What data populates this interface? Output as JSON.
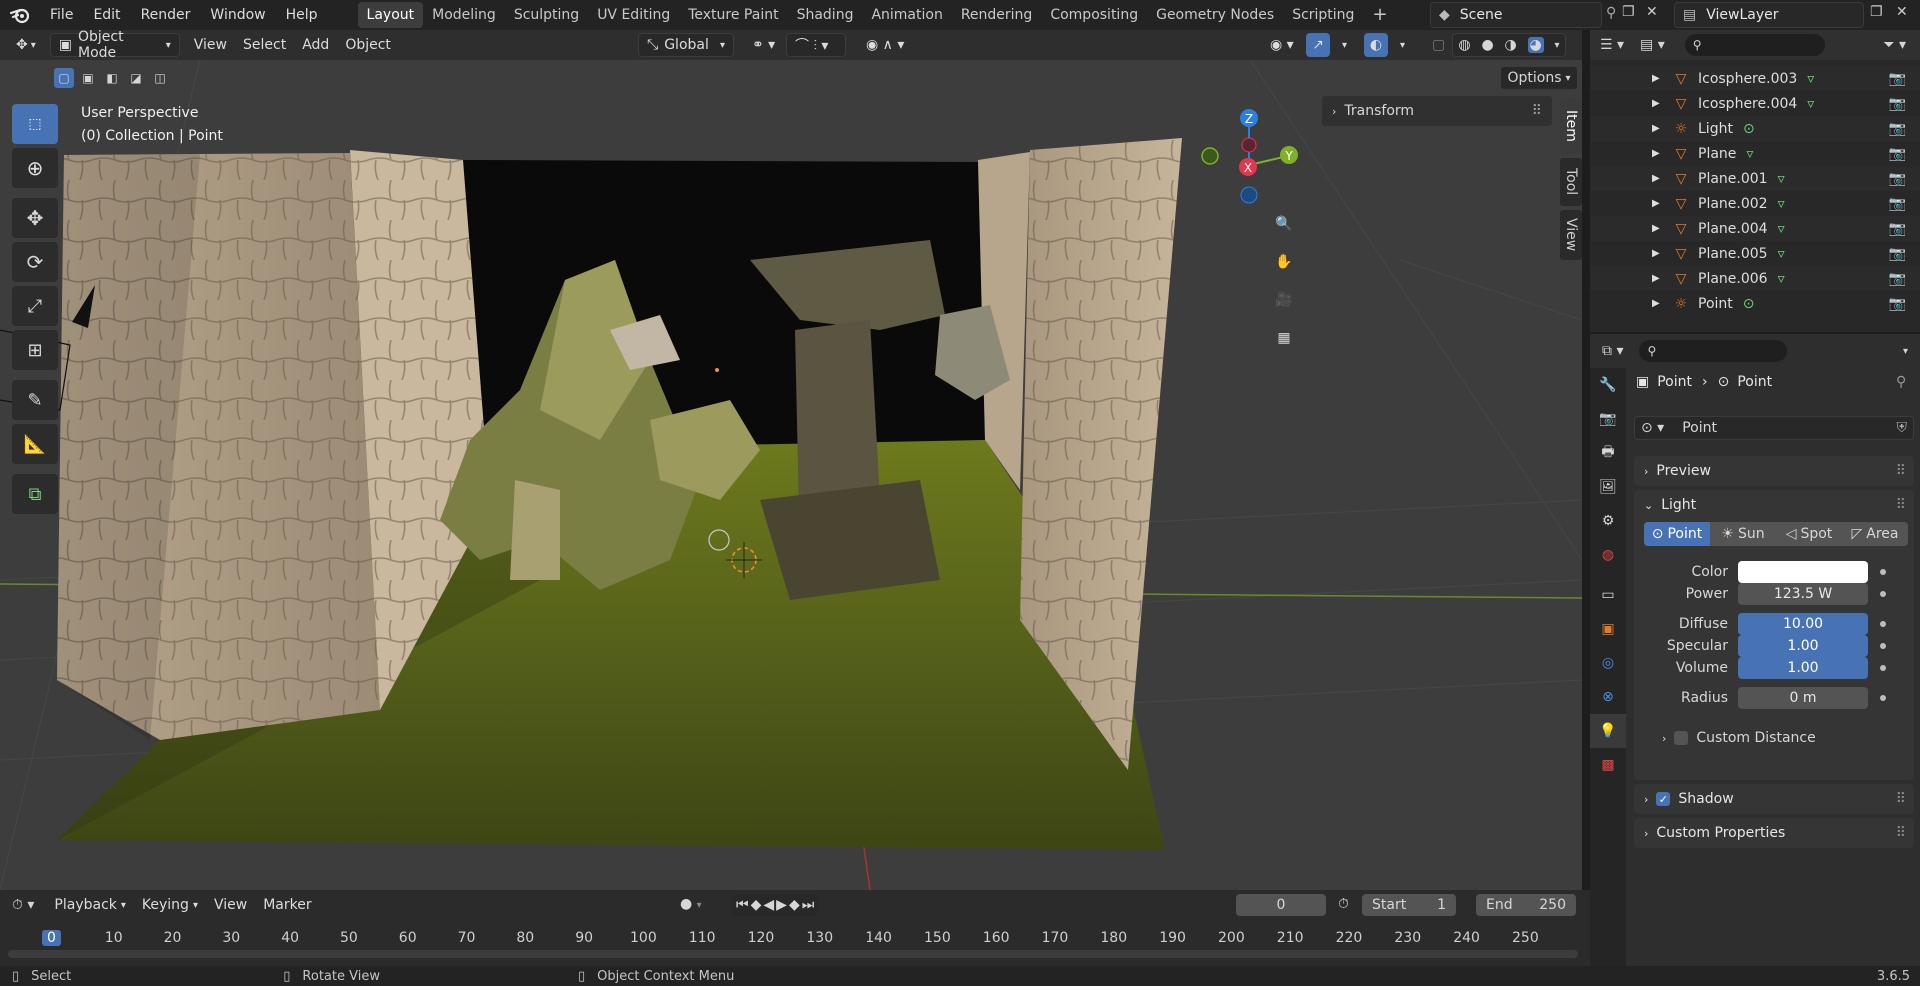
{
  "menu": [
    "File",
    "Edit",
    "Render",
    "Window",
    "Help"
  ],
  "workspaces": [
    "Layout",
    "Modeling",
    "Sculpting",
    "UV Editing",
    "Texture Paint",
    "Shading",
    "Animation",
    "Rendering",
    "Compositing",
    "Geometry Nodes",
    "Scripting"
  ],
  "active_workspace": "Layout",
  "scene": "Scene",
  "view_layer": "ViewLayer",
  "header": {
    "mode": "Object Mode",
    "view": "View",
    "select": "Select",
    "add": "Add",
    "object": "Object",
    "transform": "Global",
    "options": "Options"
  },
  "viewport": {
    "perspective": "User Perspective",
    "collection": "(0) Collection | Point"
  },
  "gizmo": {
    "z": "Z",
    "y": "Y",
    "x": "X"
  },
  "npanel": {
    "transform": "Transform",
    "tabs": [
      "Item",
      "Tool",
      "View"
    ]
  },
  "outliner": {
    "items": [
      {
        "name": "Icosphere.003",
        "type": "mesh"
      },
      {
        "name": "Icosphere.004",
        "type": "mesh"
      },
      {
        "name": "Light",
        "type": "light"
      },
      {
        "name": "Plane",
        "type": "mesh"
      },
      {
        "name": "Plane.001",
        "type": "mesh"
      },
      {
        "name": "Plane.002",
        "type": "mesh"
      },
      {
        "name": "Plane.004",
        "type": "mesh"
      },
      {
        "name": "Plane.005",
        "type": "mesh"
      },
      {
        "name": "Plane.006",
        "type": "mesh"
      },
      {
        "name": "Point",
        "type": "light"
      }
    ]
  },
  "properties": {
    "breadcrumb": [
      "Point",
      "Point"
    ],
    "datablock": "Point",
    "sections": {
      "preview": "Preview",
      "light": "Light",
      "shadow": "Shadow",
      "custom_props": "Custom Properties",
      "custom_distance": "Custom Distance"
    },
    "light_types": [
      "Point",
      "Sun",
      "Spot",
      "Area"
    ],
    "active_light_type": "Point",
    "fields": [
      {
        "label": "Color",
        "value": "",
        "kind": "color"
      },
      {
        "label": "Power",
        "value": "123.5 W",
        "kind": "plain"
      },
      {
        "label": "Diffuse",
        "value": "10.00",
        "kind": "blue"
      },
      {
        "label": "Specular",
        "value": "1.00",
        "kind": "blue"
      },
      {
        "label": "Volume",
        "value": "1.00",
        "kind": "blue"
      },
      {
        "label": "Radius",
        "value": "0 m",
        "kind": "plain"
      }
    ],
    "shadow_checked": true,
    "custom_distance_checked": false
  },
  "timeline": {
    "menus": [
      "Playback",
      "Keying",
      "View",
      "Marker"
    ],
    "current_frame": "0",
    "start_label": "Start",
    "start": "1",
    "end_label": "End",
    "end": "250",
    "ticks": [
      "0",
      "10",
      "20",
      "30",
      "40",
      "50",
      "60",
      "70",
      "80",
      "90",
      "100",
      "110",
      "120",
      "130",
      "140",
      "150",
      "160",
      "170",
      "180",
      "190",
      "200",
      "210",
      "220",
      "230",
      "240",
      "250"
    ]
  },
  "status": {
    "select": "Select",
    "rotate": "Rotate View",
    "context": "Object Context Menu",
    "version": "3.6.5"
  },
  "colors": {
    "accent": "#4772b3",
    "x_axis": "#e3374f",
    "y_axis": "#7fb02a",
    "z_axis": "#2a7fe0"
  }
}
